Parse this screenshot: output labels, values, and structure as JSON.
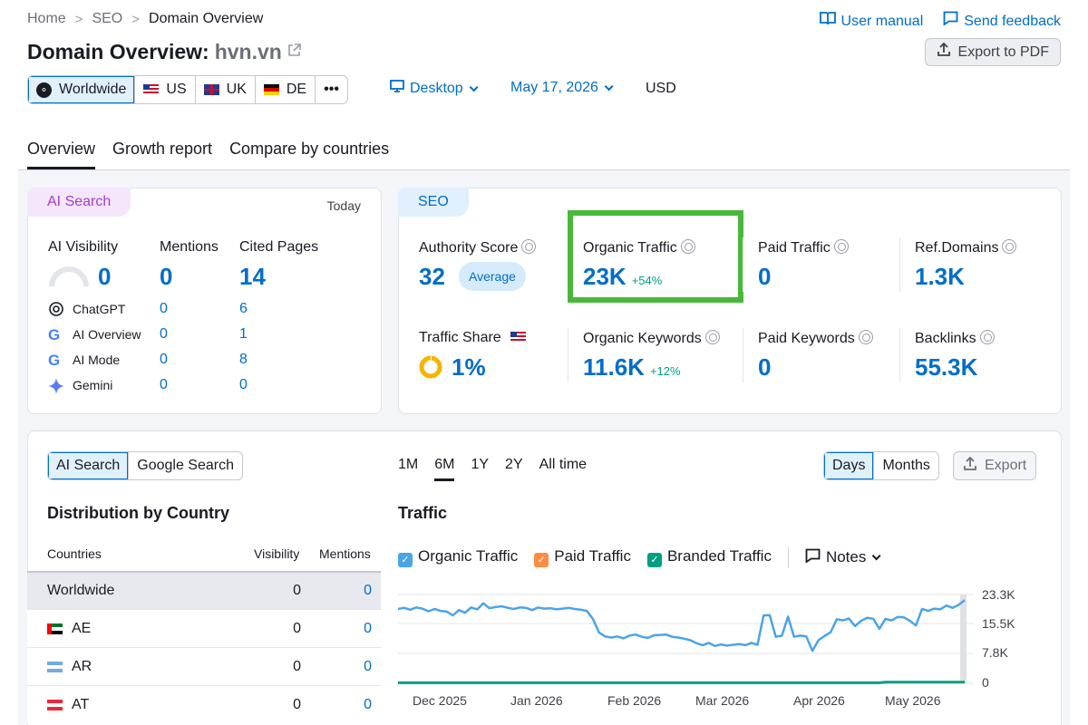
{
  "breadcrumb": [
    "Home",
    "SEO",
    "Domain Overview"
  ],
  "top_links": {
    "manual": "User manual",
    "feedback": "Send feedback"
  },
  "title": {
    "prefix": "Domain Overview:",
    "domain": "hvn.vn"
  },
  "export_pdf": "Export to PDF",
  "regions": [
    {
      "label": "Worldwide",
      "active": true
    },
    {
      "label": "US",
      "active": false
    },
    {
      "label": "UK",
      "active": false
    },
    {
      "label": "DE",
      "active": false
    },
    {
      "label": "•••",
      "active": false
    }
  ],
  "device": "Desktop",
  "date": "May 17, 2026",
  "currency": "USD",
  "tabs": [
    "Overview",
    "Growth report",
    "Compare by countries"
  ],
  "ai_card": {
    "pill": "AI Search",
    "today": "Today",
    "headers": {
      "visibility": "AI Visibility",
      "mentions": "Mentions",
      "cited": "Cited Pages"
    },
    "totals": {
      "visibility": "0",
      "mentions": "0",
      "cited": "14"
    },
    "rows": [
      {
        "name": "ChatGPT",
        "mentions": "0",
        "cited": "6"
      },
      {
        "name": "AI Overview",
        "mentions": "0",
        "cited": "1"
      },
      {
        "name": "AI Mode",
        "mentions": "0",
        "cited": "8"
      },
      {
        "name": "Gemini",
        "mentions": "0",
        "cited": "0"
      }
    ]
  },
  "seo_card": {
    "pill": "SEO",
    "authority": {
      "label": "Authority Score",
      "value": "32",
      "badge": "Average"
    },
    "organic_traffic": {
      "label": "Organic Traffic",
      "value": "23K",
      "delta": "+54%"
    },
    "paid_traffic": {
      "label": "Paid Traffic",
      "value": "0"
    },
    "ref_domains": {
      "label": "Ref.Domains",
      "value": "1.3K"
    },
    "traffic_share": {
      "label": "Traffic Share",
      "value": "1%"
    },
    "organic_keywords": {
      "label": "Organic Keywords",
      "value": "11.6K",
      "delta": "+12%"
    },
    "paid_keywords": {
      "label": "Paid Keywords",
      "value": "0"
    },
    "backlinks": {
      "label": "Backlinks",
      "value": "55.3K"
    }
  },
  "bottom": {
    "search_toggle": [
      "AI Search",
      "Google Search"
    ],
    "dist_title": "Distribution by Country",
    "table_headers": {
      "countries": "Countries",
      "visibility": "Visibility",
      "mentions": "Mentions"
    },
    "table_rows": [
      {
        "country": "Worldwide",
        "visibility": "0",
        "mentions": "0"
      },
      {
        "country": "AE",
        "visibility": "0",
        "mentions": "0"
      },
      {
        "country": "AR",
        "visibility": "0",
        "mentions": "0"
      },
      {
        "country": "AT",
        "visibility": "0",
        "mentions": "0"
      }
    ],
    "ranges": [
      "1M",
      "6M",
      "1Y",
      "2Y",
      "All time"
    ],
    "granularity": [
      "Days",
      "Months"
    ],
    "export": "Export",
    "traffic_title": "Traffic",
    "legend": {
      "organic": "Organic Traffic",
      "paid": "Paid Traffic",
      "branded": "Branded Traffic",
      "notes": "Notes"
    }
  },
  "colors": {
    "accent": "#006dca",
    "organic": "#4aa4e8",
    "paid": "#ff8c43",
    "branded": "#009f81",
    "highlight": "#49b83a"
  },
  "chart_data": {
    "type": "line",
    "x_ticks": [
      "Dec 2025",
      "Jan 2026",
      "Feb 2026",
      "Mar 2026",
      "Apr 2026",
      "May 2026"
    ],
    "y_ticks": [
      "23.3K",
      "15.5K",
      "7.8K",
      "0"
    ],
    "ylim": [
      0,
      23300
    ],
    "series": [
      {
        "name": "Organic Traffic",
        "values": [
          19500,
          19800,
          19300,
          19900,
          19600,
          18900,
          19500,
          19000,
          18800,
          17800,
          19200,
          18500,
          19900,
          19400,
          21000,
          19700,
          20000,
          20200,
          19800,
          19500,
          19900,
          19800,
          19200,
          19900,
          19600,
          19700,
          19400,
          19600,
          19800,
          19500,
          19300,
          19000,
          16800,
          13300,
          12300,
          12000,
          12300,
          11800,
          12500,
          12800,
          12200,
          11900,
          12600,
          12700,
          12800,
          12200,
          12000,
          11700,
          11300,
          10500,
          10000,
          10600,
          9800,
          10200,
          9900,
          10100,
          10300,
          10000,
          10600,
          10100,
          17800,
          17900,
          12200,
          12500,
          17500,
          12200,
          12500,
          12300,
          8500,
          11300,
          12400,
          13400,
          16800,
          16500,
          17000,
          15000,
          16400,
          17200,
          16900,
          14300,
          16900,
          16500,
          17400,
          17300,
          16400,
          15200,
          19500,
          19000,
          19600,
          19400,
          20400,
          19800,
          20600,
          21800
        ]
      },
      {
        "name": "Branded Traffic",
        "values": [
          150,
          150,
          150,
          150,
          150,
          150,
          150,
          150,
          150,
          150,
          150,
          150,
          150,
          150,
          150,
          150,
          150,
          150,
          150,
          150,
          150,
          150,
          150,
          150,
          150,
          150,
          150,
          150,
          150,
          150,
          150,
          150,
          150,
          150,
          150,
          150,
          150,
          150,
          150,
          150,
          150,
          150,
          150,
          150,
          150,
          150,
          150,
          150,
          150,
          150,
          150,
          150,
          150,
          150,
          150,
          150,
          150,
          150,
          150,
          150,
          150,
          150,
          150,
          150,
          150,
          150,
          150,
          150,
          150,
          150,
          150,
          150,
          150,
          150,
          150,
          150,
          150,
          150,
          150,
          150,
          300,
          300,
          300,
          300,
          300,
          300,
          300,
          300,
          300,
          300,
          300,
          300,
          300,
          300
        ]
      }
    ]
  }
}
